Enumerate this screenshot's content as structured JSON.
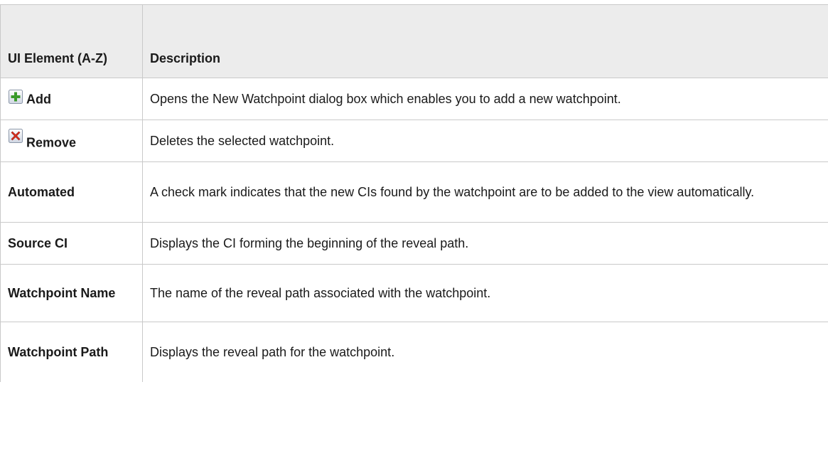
{
  "table": {
    "header": {
      "col1": "UI Element (A-Z)",
      "col2": "Description"
    },
    "rows": [
      {
        "element": "Add",
        "icon": "add-icon",
        "description": "Opens the New Watchpoint dialog box which enables you to add a new watchpoint."
      },
      {
        "element": "Remove",
        "icon": "remove-icon",
        "description": "Deletes the selected watchpoint."
      },
      {
        "element": "Automated",
        "description": "A check mark indicates that the new CIs found by the watchpoint are to be added to the view automatically."
      },
      {
        "element": "Source CI",
        "description": "Displays the CI forming the beginning of the reveal path."
      },
      {
        "element": "Watchpoint Name",
        "description": "The name of the reveal path associated with the watchpoint."
      },
      {
        "element": "Watchpoint Path",
        "description": "Displays the reveal path for the watchpoint."
      }
    ]
  },
  "colors": {
    "header_bg": "#ececec",
    "border": "#c9c9c9",
    "add_icon": "#3a9a2a",
    "remove_icon": "#d9301e"
  }
}
